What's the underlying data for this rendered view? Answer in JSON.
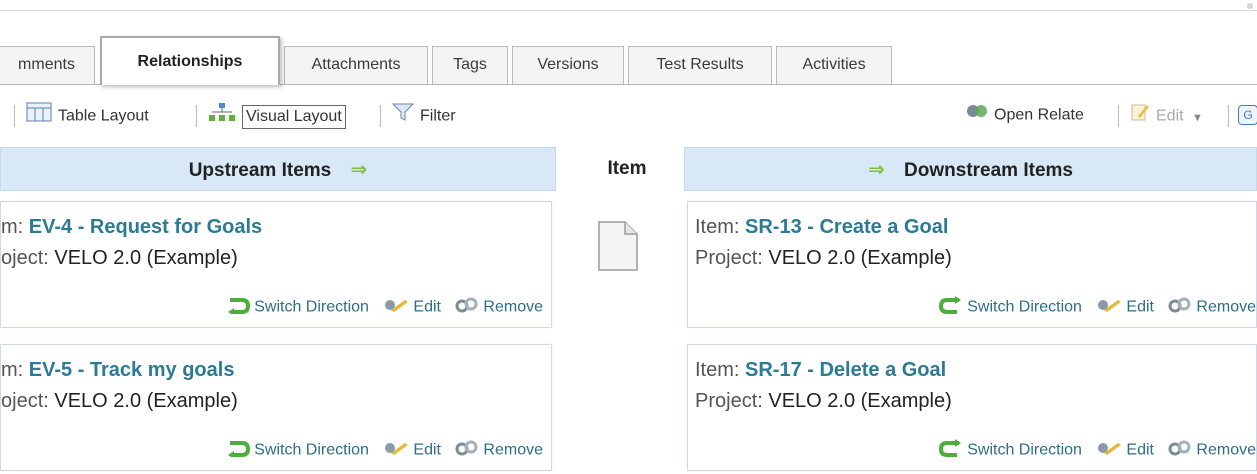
{
  "tabs": [
    {
      "label": "mments",
      "active": false
    },
    {
      "label": "Relationships",
      "active": true
    },
    {
      "label": "Attachments",
      "active": false
    },
    {
      "label": "Tags",
      "active": false
    },
    {
      "label": "Versions",
      "active": false
    },
    {
      "label": "Test Results",
      "active": false
    },
    {
      "label": "Activities",
      "active": false
    }
  ],
  "toolbar": {
    "table_layout": "Table Layout",
    "visual_layout": "Visual Layout",
    "filter": "Filter",
    "open_relate": "Open Relate",
    "edit": "Edit"
  },
  "columns": {
    "upstream": "Upstream Items",
    "item": "Item",
    "downstream": "Downstream Items"
  },
  "upstream": [
    {
      "item_label": "m:",
      "item": "EV-4 - Request for Goals",
      "project_label": "oject:",
      "project": "VELO 2.0 (Example)"
    },
    {
      "item_label": "m:",
      "item": "EV-5 - Track my goals",
      "project_label": "oject:",
      "project": "VELO 2.0 (Example)"
    }
  ],
  "downstream": [
    {
      "item_label": "Item:",
      "item": "SR-13 - Create a Goal",
      "project_label": "Project:",
      "project": "VELO 2.0 (Example)"
    },
    {
      "item_label": "Item:",
      "item": "SR-17 - Delete a Goal",
      "project_label": "Project:",
      "project": "VELO 2.0 (Example)"
    }
  ],
  "actions": {
    "switch_direction": "Switch Direction",
    "edit": "Edit",
    "remove": "Remove"
  },
  "colors": {
    "header_bg": "#d9e8f6",
    "link": "#2b7a96",
    "arrow": "#7fbf3f"
  }
}
